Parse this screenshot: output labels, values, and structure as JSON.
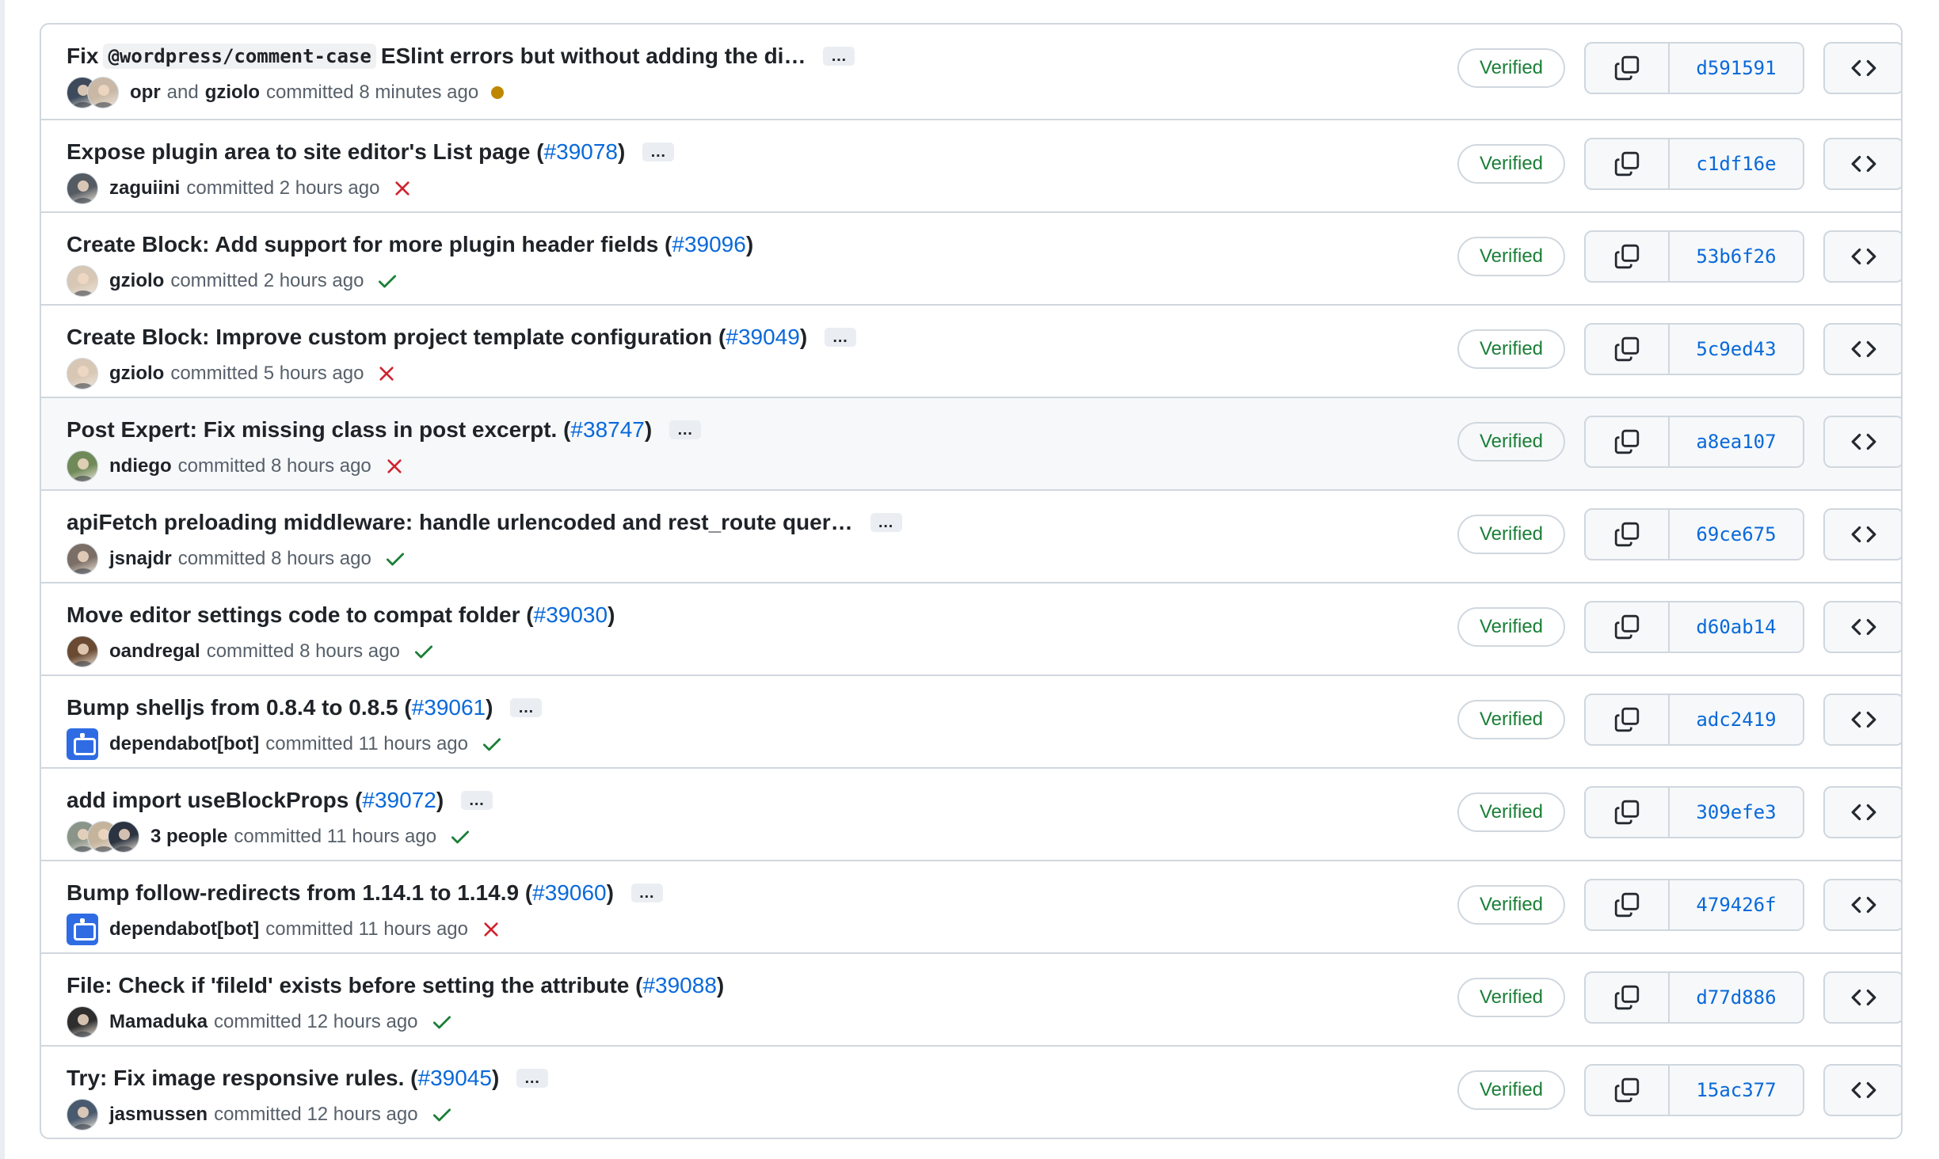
{
  "commits": [
    {
      "title_parts": [
        {
          "type": "text",
          "value": "Fix "
        },
        {
          "type": "code",
          "value": "@wordpress/comment-case"
        },
        {
          "type": "text",
          "value": " ESlint errors but without adding the di…"
        }
      ],
      "has_ellipsis": true,
      "authors": [
        "opr",
        "gziolo"
      ],
      "author_joiner": "and",
      "avatars": [
        {
          "color": "#3d4a5c"
        },
        {
          "color": "#c9b8a6"
        }
      ],
      "time": "committed 8 minutes ago",
      "status": "pending",
      "verified": "Verified",
      "sha": "d591591"
    },
    {
      "title_parts": [
        {
          "type": "text",
          "value": "Expose plugin area to site editor's List page ("
        },
        {
          "type": "link",
          "value": "#39078"
        },
        {
          "type": "text",
          "value": ")"
        }
      ],
      "has_ellipsis": true,
      "authors": [
        "zaguiini"
      ],
      "avatars": [
        {
          "color": "#555b62"
        }
      ],
      "time": "committed 2 hours ago",
      "status": "fail",
      "verified": "Verified",
      "sha": "c1df16e"
    },
    {
      "title_parts": [
        {
          "type": "text",
          "value": "Create Block: Add support for more plugin header fields ("
        },
        {
          "type": "link",
          "value": "#39096"
        },
        {
          "type": "text",
          "value": ")"
        }
      ],
      "has_ellipsis": false,
      "authors": [
        "gziolo"
      ],
      "avatars": [
        {
          "color": "#d8c7b5"
        }
      ],
      "time": "committed 2 hours ago",
      "status": "ok",
      "verified": "Verified",
      "sha": "53b6f26"
    },
    {
      "title_parts": [
        {
          "type": "text",
          "value": "Create Block: Improve custom project template configuration ("
        },
        {
          "type": "link",
          "value": "#39049"
        },
        {
          "type": "text",
          "value": ")"
        }
      ],
      "has_ellipsis": true,
      "authors": [
        "gziolo"
      ],
      "avatars": [
        {
          "color": "#d8c7b5"
        }
      ],
      "time": "committed 5 hours ago",
      "status": "fail",
      "verified": "Verified",
      "sha": "5c9ed43"
    },
    {
      "title_parts": [
        {
          "type": "text",
          "value": "Post Expert: Fix missing class in post excerpt. ("
        },
        {
          "type": "link",
          "value": "#38747"
        },
        {
          "type": "text",
          "value": ")"
        }
      ],
      "has_ellipsis": true,
      "authors": [
        "ndiego"
      ],
      "avatars": [
        {
          "color": "#6f8a58"
        }
      ],
      "time": "committed 8 hours ago",
      "status": "fail",
      "verified": "Verified",
      "sha": "a8ea107",
      "hover": true
    },
    {
      "title_parts": [
        {
          "type": "text",
          "value": "apiFetch preloading middleware: handle urlencoded and rest_route quer…"
        }
      ],
      "has_ellipsis": true,
      "authors": [
        "jsnajdr"
      ],
      "avatars": [
        {
          "color": "#7b6e66"
        }
      ],
      "time": "committed 8 hours ago",
      "status": "ok",
      "verified": "Verified",
      "sha": "69ce675"
    },
    {
      "title_parts": [
        {
          "type": "text",
          "value": "Move editor settings code to compat folder ("
        },
        {
          "type": "link",
          "value": "#39030"
        },
        {
          "type": "text",
          "value": ")"
        }
      ],
      "has_ellipsis": false,
      "authors": [
        "oandregal"
      ],
      "avatars": [
        {
          "color": "#6b4a33"
        }
      ],
      "time": "committed 8 hours ago",
      "status": "ok",
      "verified": "Verified",
      "sha": "d60ab14"
    },
    {
      "title_parts": [
        {
          "type": "text",
          "value": "Bump shelljs from 0.8.4 to 0.8.5 ("
        },
        {
          "type": "link",
          "value": "#39061"
        },
        {
          "type": "text",
          "value": ")"
        }
      ],
      "has_ellipsis": true,
      "authors": [
        "dependabot[bot]"
      ],
      "avatars": [
        {
          "bot": true
        }
      ],
      "time": "committed 11 hours ago",
      "status": "ok",
      "verified": "Verified",
      "sha": "adc2419"
    },
    {
      "title_parts": [
        {
          "type": "text",
          "value": "add import useBlockProps ("
        },
        {
          "type": "link",
          "value": "#39072"
        },
        {
          "type": "text",
          "value": ")"
        }
      ],
      "has_ellipsis": true,
      "authors": [
        "3 people"
      ],
      "avatars": [
        {
          "color": "#8a9488"
        },
        {
          "color": "#c4b49c"
        },
        {
          "color": "#2b3440"
        }
      ],
      "time": "committed 11 hours ago",
      "status": "ok",
      "verified": "Verified",
      "sha": "309efe3"
    },
    {
      "title_parts": [
        {
          "type": "text",
          "value": "Bump follow-redirects from 1.14.1 to 1.14.9 ("
        },
        {
          "type": "link",
          "value": "#39060"
        },
        {
          "type": "text",
          "value": ")"
        }
      ],
      "has_ellipsis": true,
      "authors": [
        "dependabot[bot]"
      ],
      "avatars": [
        {
          "bot": true
        }
      ],
      "time": "committed 11 hours ago",
      "status": "fail",
      "verified": "Verified",
      "sha": "479426f"
    },
    {
      "title_parts": [
        {
          "type": "text",
          "value": "File: Check if 'fileId' exists before setting the attribute ("
        },
        {
          "type": "link",
          "value": "#39088"
        },
        {
          "type": "text",
          "value": ")"
        }
      ],
      "has_ellipsis": false,
      "authors": [
        "Mamaduka"
      ],
      "avatars": [
        {
          "color": "#2e2e2e"
        }
      ],
      "time": "committed 12 hours ago",
      "status": "ok",
      "verified": "Verified",
      "sha": "d77d886"
    },
    {
      "title_parts": [
        {
          "type": "text",
          "value": "Try: Fix image responsive rules. ("
        },
        {
          "type": "link",
          "value": "#39045"
        },
        {
          "type": "text",
          "value": ")"
        }
      ],
      "has_ellipsis": true,
      "authors": [
        "jasmussen"
      ],
      "avatars": [
        {
          "color": "#4a5a6e"
        }
      ],
      "time": "committed 12 hours ago",
      "status": "ok",
      "verified": "Verified",
      "sha": "15ac377"
    }
  ],
  "ellipsis_label": "…",
  "colors": {
    "link": "#0969da",
    "verified": "#1a7f37",
    "fail": "#cf222e",
    "ok": "#1a7f37",
    "pending": "#bf8700"
  },
  "icons": {
    "copy": "copy-icon",
    "browse": "code-icon",
    "fail": "x-icon",
    "ok": "check-icon",
    "pending": "dot-icon"
  }
}
